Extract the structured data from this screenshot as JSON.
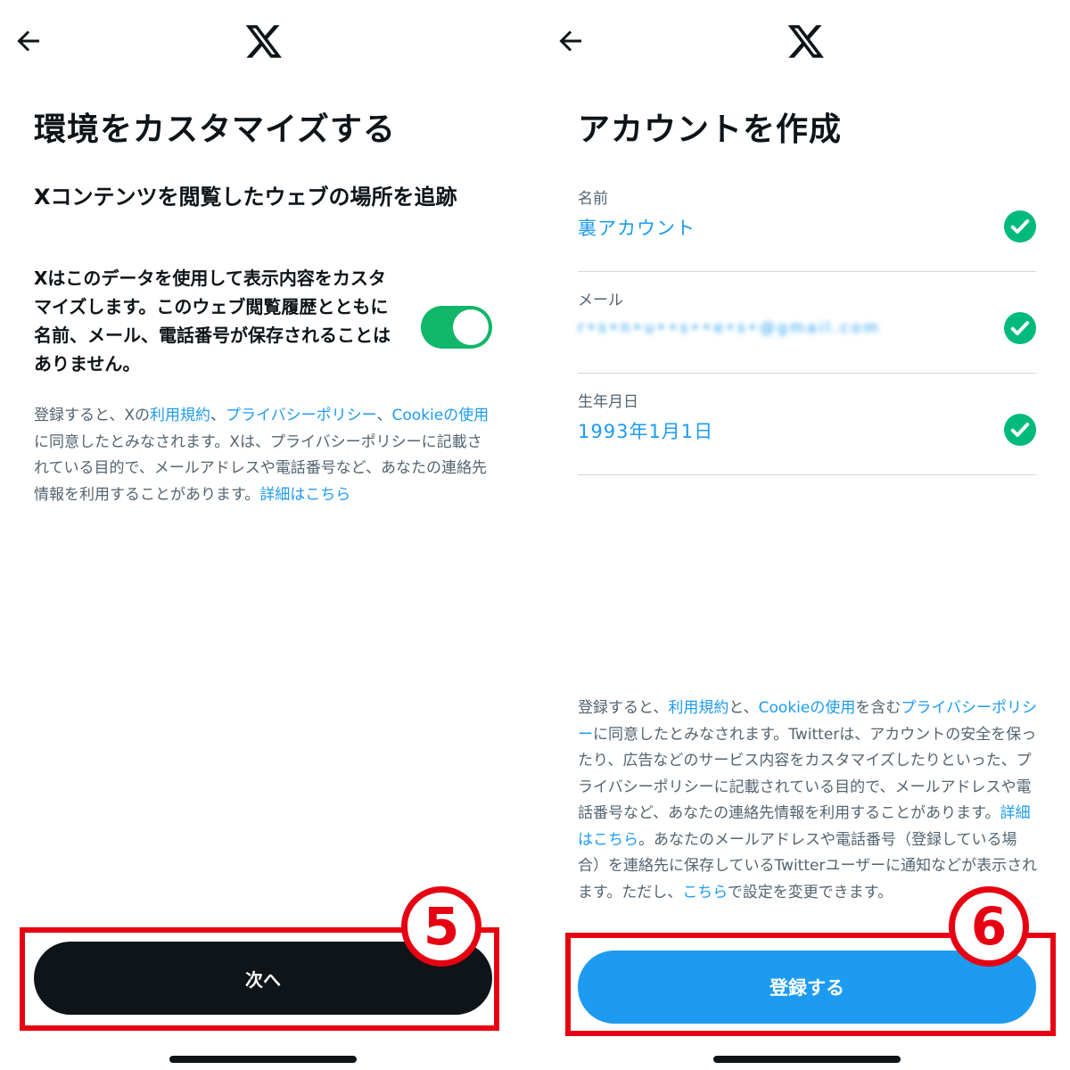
{
  "left": {
    "title": "環境をカスタマイズする",
    "section_heading": "Xコンテンツを閲覧したウェブの場所を追跡",
    "toggle_description": "Xはこのデータを使用して表示内容をカスタマイズします。このウェブ閲覧履歴とともに名前、メール、電話番号が保存されることはありません。",
    "toggle_state": "on",
    "fine_print": {
      "p1": "登録すると、Xの",
      "link_terms": "利用規約",
      "p2": "、",
      "link_privacy": "プライバシーポリシー",
      "p3": "、",
      "link_cookie": "Cookieの使用",
      "p4": "に同意したとみなされます。Xは、プライバシーポリシーに記載されている目的で、メールアドレスや電話番号など、あなたの連絡先情報を利用することがあります。",
      "link_details": "詳細はこちら"
    },
    "next_button": "次へ",
    "step_marker": "5"
  },
  "right": {
    "title": "アカウントを作成",
    "fields": [
      {
        "label": "名前",
        "value": "裏アカウント"
      },
      {
        "label": "メール",
        "value": "r•s•n•u••s••e•s•@gmail.com"
      },
      {
        "label": "生年月日",
        "value": "1993年1月1日"
      }
    ],
    "fine_print": {
      "p1": "登録すると、",
      "link_terms": "利用規約",
      "p2": "と、",
      "link_cookie": "Cookieの使用",
      "p3": "を含む",
      "link_privacy": "プライバシーポリシー",
      "p4": "に同意したとみなされます。Twitterは、アカウントの安全を保ったり、広告などのサービス内容をカスタマイズしたりといった、プライバシーポリシーに記載されている目的で、メールアドレスや電話番号など、あなたの連絡先情報を利用することがあります。",
      "link_details": "詳細はこちら",
      "p5": "。あなたのメールアドレスや電話番号（登録している場合）を連絡先に保存しているTwitterユーザーに通知などが表示されます。ただし、",
      "link_here": "こちら",
      "p6": "で設定を変更できます。"
    },
    "signup_button": "登録する",
    "step_marker": "6"
  },
  "colors": {
    "accent": "#1d9bf0",
    "toggle_on": "#11b669",
    "check": "#00ba7c",
    "highlight": "#e60012",
    "button_dark": "#0f1419"
  },
  "icons": {
    "back": "arrow-left-icon",
    "logo": "x-logo-icon",
    "check": "check-circle-icon"
  }
}
